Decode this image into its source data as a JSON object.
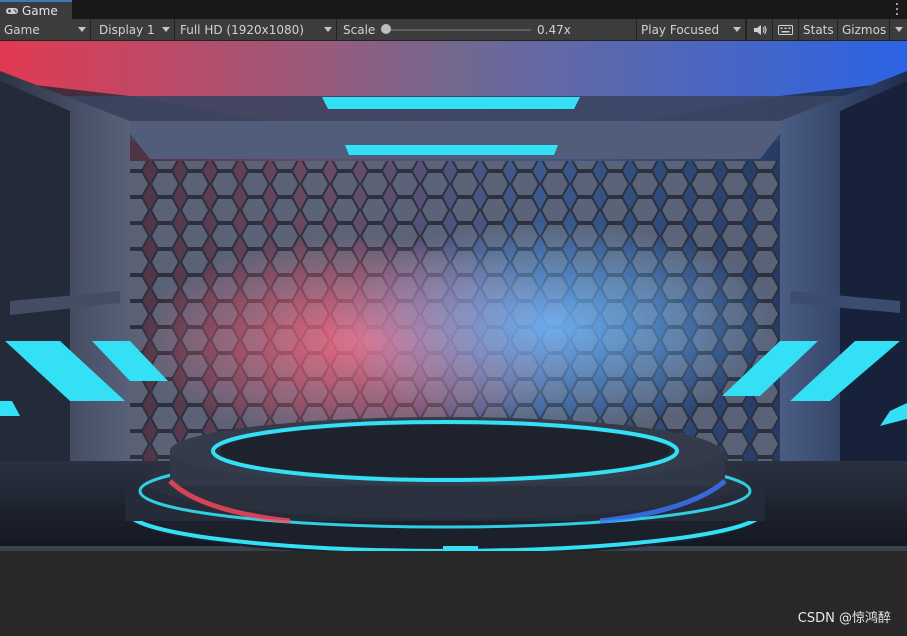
{
  "tab": {
    "label": "Game",
    "icon": "gamepad-icon"
  },
  "toolbar": {
    "view_mode": "Game",
    "display": "Display 1",
    "resolution": "Full HD (1920x1080)",
    "scale_label": "Scale",
    "scale_value": "0.47x",
    "play_mode": "Play Focused",
    "audio_icon": "speaker-icon",
    "keyboard_icon": "keyboard-icon",
    "stats_label": "Stats",
    "gizmos_label": "Gizmos"
  },
  "scene": {
    "description_colors": {
      "cyan": "#33e0f5",
      "red": "#ff4a5c",
      "blue": "#3b78ff",
      "hex_gray": "#7d8aa0"
    }
  },
  "watermark": "CSDN @惊鸿醉"
}
